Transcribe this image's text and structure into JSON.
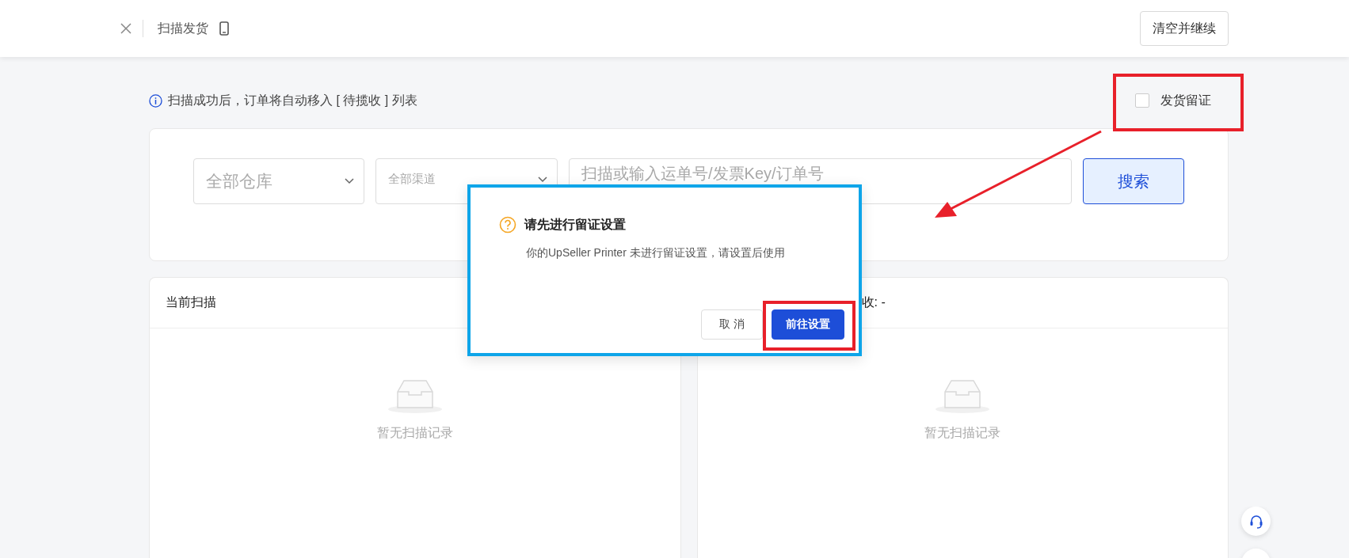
{
  "top_bar": {
    "title": "扫描发货",
    "clear_button": "清空并继续"
  },
  "notice": "扫描成功后，订单将自动移入 [ 待揽收 ] 列表",
  "proof_checkbox": {
    "label": "发货留证",
    "checked": false
  },
  "filters": {
    "warehouse": "全部仓库",
    "channel": "全部渠道",
    "search_placeholder": "扫描或输入运单号/发票Key/订单号",
    "search_button": "搜索"
  },
  "panels": [
    {
      "title": "当前扫描",
      "empty_text": "暂无扫描记录"
    },
    {
      "title": "收: -",
      "empty_text": "暂无扫描记录"
    }
  ],
  "dialog": {
    "title": "请先进行留证设置",
    "message": "你的UpSeller Printer 未进行留证设置，请设置后使用",
    "buttons": [
      {
        "label": "取 消",
        "kind": "secondary"
      },
      {
        "label": "前往设置",
        "kind": "primary"
      }
    ]
  }
}
